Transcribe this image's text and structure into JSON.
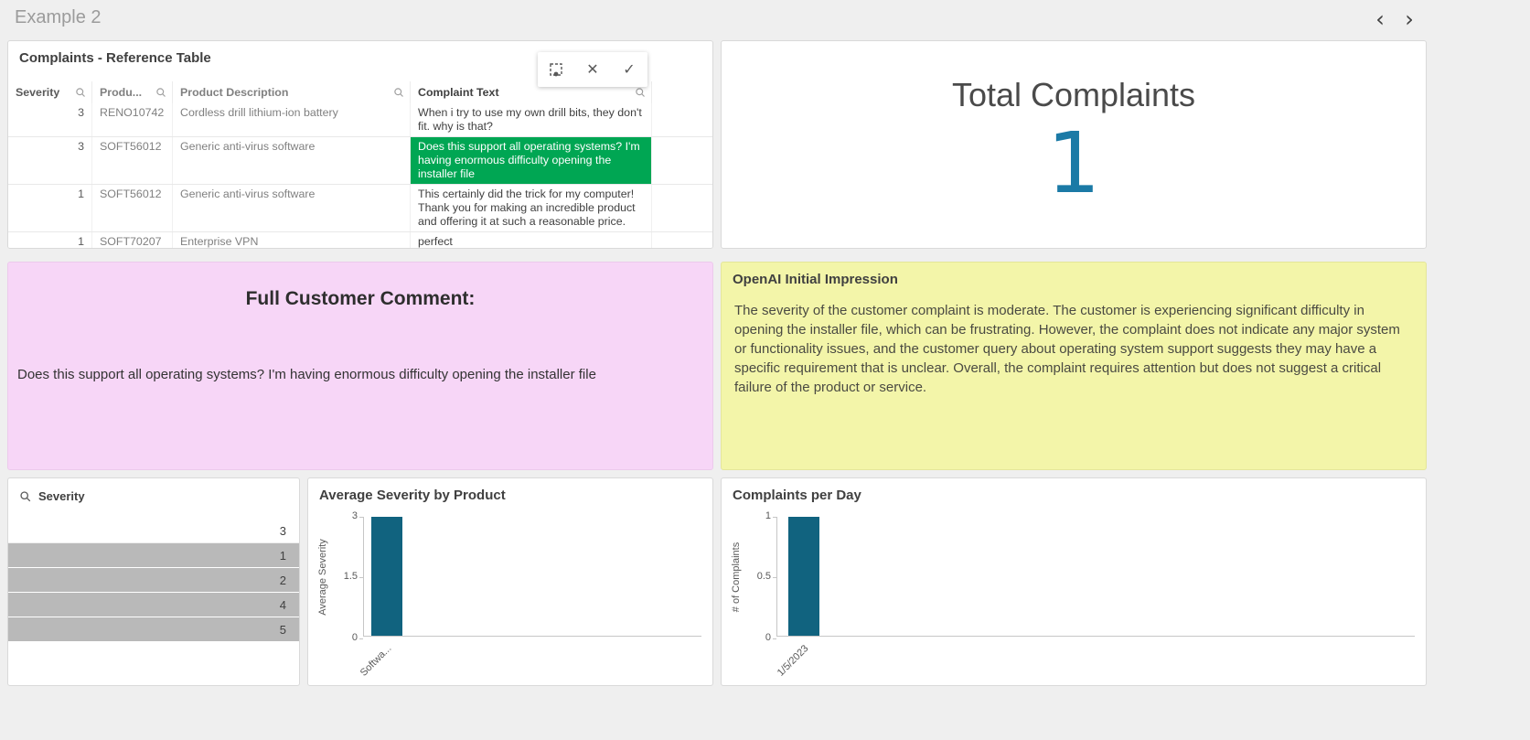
{
  "page": {
    "title": "Example 2"
  },
  "toolbar": {
    "prev_icon": "‹",
    "next_icon": "›"
  },
  "selection_toolbar": {
    "lasso_icon_name": "lasso-selection-icon",
    "cancel_icon": "✕",
    "confirm_icon": "✓"
  },
  "reference_table": {
    "title": "Complaints - Reference Table",
    "columns": [
      "Severity",
      "Produ...",
      "Product Description",
      "Complaint Text"
    ],
    "rows": [
      {
        "severity": "3",
        "product": "RENO10742",
        "description": "Cordless drill lithium-ion battery",
        "text": "When i try to use my own drill bits, they don't fit. why is that?",
        "state": "normal"
      },
      {
        "severity": "3",
        "product": "SOFT56012",
        "description": "Generic anti-virus software",
        "text": "Does this support all operating systems? I'm having enormous difficulty opening the installer file",
        "state": "selected"
      },
      {
        "severity": "1",
        "product": "SOFT56012",
        "description": "Generic anti-virus software",
        "text": "This certainly did the trick for my computer! Thank you for making an incredible product and offering it at such a reasonable price.",
        "state": "normal"
      },
      {
        "severity": "1",
        "product": "SOFT70207",
        "description": "Enterprise VPN",
        "text": "perfect",
        "state": "normal"
      }
    ]
  },
  "kpi": {
    "title": "Total Complaints",
    "value": "1"
  },
  "comment_panel": {
    "title": "Full Customer Comment:",
    "text": "Does this support all operating systems? I'm having enormous difficulty opening the installer file"
  },
  "ai_panel": {
    "title": "OpenAI Initial Impression",
    "text": "The severity of the customer complaint is moderate. The customer is experiencing significant difficulty in opening the installer file, which can be frustrating. However, the complaint does not indicate any major system or functionality issues, and the customer query about operating system support suggests they may have a specific requirement that is unclear. Overall, the complaint requires attention but does not suggest a critical failure of the product or service."
  },
  "severity_filter": {
    "title": "Severity",
    "items": [
      {
        "value": "3",
        "state": "possible"
      },
      {
        "value": "1",
        "state": "excluded"
      },
      {
        "value": "2",
        "state": "excluded"
      },
      {
        "value": "4",
        "state": "excluded"
      },
      {
        "value": "5",
        "state": "excluded"
      }
    ]
  },
  "chart_data": [
    {
      "type": "bar",
      "title": "Average Severity by Product",
      "ylabel": "Average Severity",
      "xlabel": "",
      "categories": [
        "Softwa..."
      ],
      "values": [
        3
      ],
      "ylim": [
        0,
        3
      ],
      "yticks": [
        0,
        1.5,
        3
      ],
      "grid": false,
      "legend": "none"
    },
    {
      "type": "bar",
      "title": "Complaints per Day",
      "ylabel": "# of Complaints",
      "xlabel": "",
      "categories": [
        "1/5/2023"
      ],
      "values": [
        1
      ],
      "ylim": [
        0,
        1
      ],
      "yticks": [
        0,
        0.5,
        1
      ],
      "grid": false,
      "legend": "none"
    }
  ],
  "colors": {
    "background": "#efefef",
    "panel_border": "#d9d9d9",
    "selected_green": "#00a653",
    "bar": "#11637f",
    "kpi_value": "#1b7aa6",
    "comment_bg": "#f7d6f7",
    "ai_bg": "#f3f5a9",
    "excluded_gray": "#b9b9b9"
  }
}
